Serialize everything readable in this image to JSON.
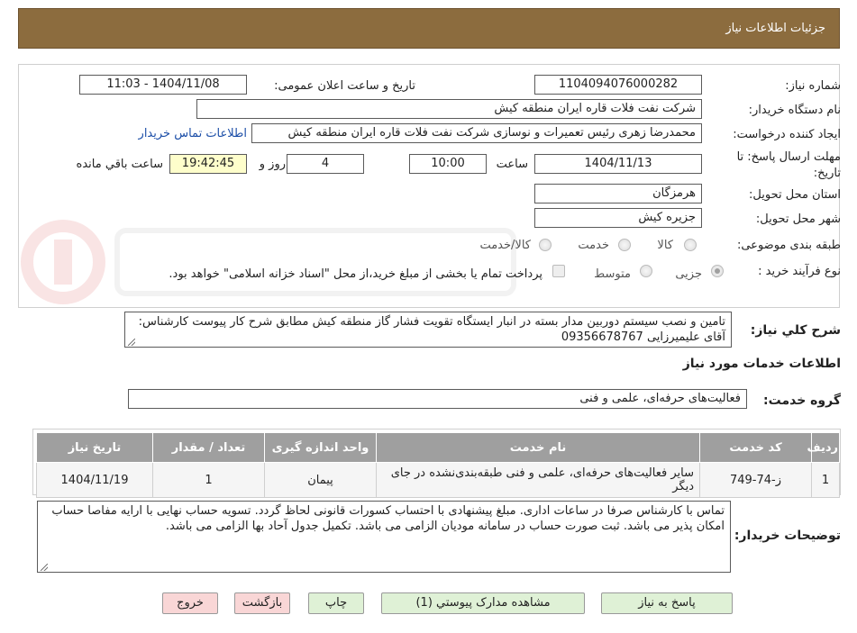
{
  "header": {
    "title": "جزئیات اطلاعات نیاز"
  },
  "form": {
    "need_number_label": "شماره نیاز:",
    "need_number": "1104094076000282",
    "announce_label": "تاریخ و ساعت اعلان عمومی:",
    "announce_value": "1404/11/08 - 11:03",
    "buyer_org_label": "نام دستگاه خریدار:",
    "buyer_org": "شرکت نفت فلات قاره ایران منطقه کیش",
    "requester_label": "ایجاد کننده درخواست:",
    "requester": "محمدرضا  زهری رئیس تعمیرات و نوسازی  شرکت نفت فلات قاره ایران منطقه کیش",
    "contact_link": "اطلاعات تماس خریدار",
    "deadline_label": "مهلت ارسال پاسخ: تا تاریخ:",
    "deadline_date": "1404/11/13",
    "time_label": "ساعت",
    "deadline_time": "10:00",
    "days_value": "4",
    "days_label": "روز و",
    "remaining_time": "19:42:45",
    "remaining_label": "ساعت باقي مانده",
    "province_label": "استان محل تحویل:",
    "province": "هرمزگان",
    "city_label": "شهر محل تحویل:",
    "city": "جزیره کیش",
    "category_label": "طبقه بندی موضوعی:",
    "category_options": [
      "کالا",
      "خدمت",
      "کالا/خدمت"
    ],
    "process_label": "نوع فرآیند خرید :",
    "process_options": [
      "جزیی",
      "متوسط"
    ],
    "payment_note": "پرداخت تمام یا بخشی از مبلغ خرید،از محل \"اسناد خزانه اسلامی\" خواهد بود."
  },
  "description": {
    "label": "شرح کلي نياز:",
    "text": "تامین و نصب سیستم دوربین مدار بسته در انبار ایستگاه تقویت فشار گاز منطقه کیش مطابق شرح کار پیوست کارشناس: آقای علیمیرزایی 09356678767"
  },
  "services": {
    "section_title": "اطلاعات خدمات مورد نياز",
    "group_label": "گروه خدمت:",
    "group_value": "فعالیت‌های حرفه‌ای، علمی و فنی",
    "columns": [
      "ردیف",
      "کد خدمت",
      "نام خدمت",
      "واحد اندازه گیری",
      "تعداد / مقدار",
      "تاریخ نیاز"
    ],
    "rows": [
      {
        "row": "1",
        "code": "ز-74-749",
        "name": "سایر فعالیت‌های حرفه‌ای، علمی و فنی طبقه‌بندی‌نشده در جای دیگر",
        "unit": "پیمان",
        "qty": "1",
        "date": "1404/11/19"
      }
    ]
  },
  "buyer_notes": {
    "label": "توضیحات خریدار:",
    "text": "تماس با کارشناس صرفا در ساعات اداری. مبلغ پیشنهادی با احتساب کسورات قانونی لحاظ گردد. تسویه حساب نهایی با ارایه مفاصا حساب امکان پذیر می باشد. ثبت صورت حساب در سامانه مودیان الزامی می باشد. تکمیل جدول آحاد بها الزامی می باشد."
  },
  "buttons": {
    "reply": "پاسخ به نیاز",
    "attachments": "مشاهده مدارک پیوستي (1)",
    "print": "چاپ",
    "back": "بازگشت",
    "exit": "خروج"
  },
  "colors": {
    "header_bg": "#8c6c3e",
    "table_header_bg": "#9f9f9f",
    "link": "#1d4fa8"
  }
}
